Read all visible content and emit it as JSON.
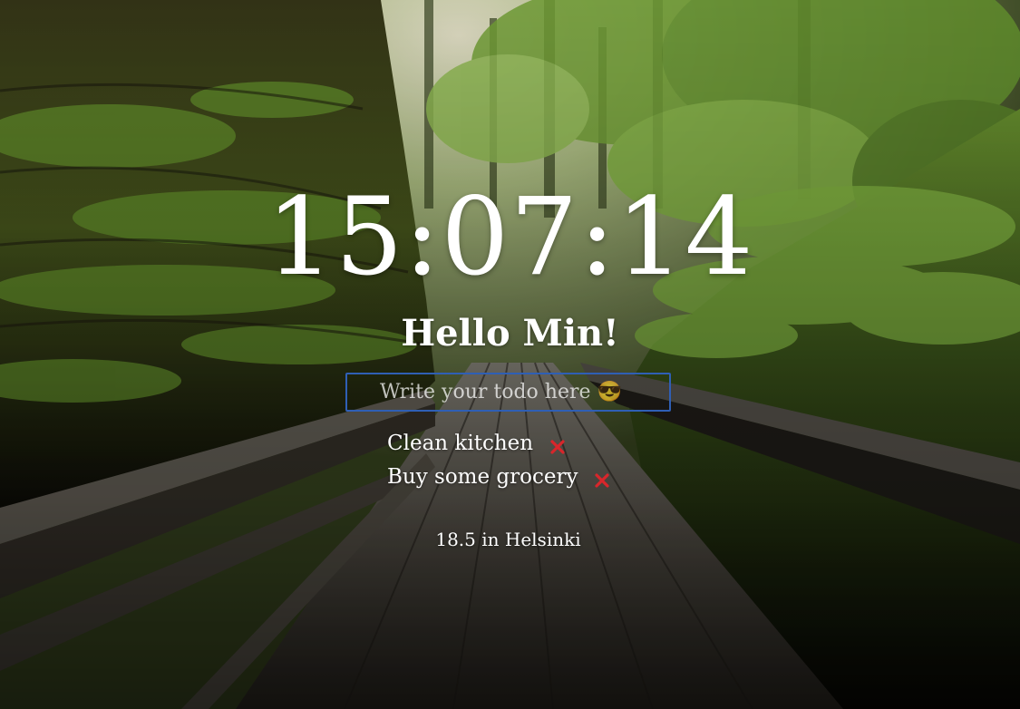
{
  "clock": {
    "time": "15:07:14"
  },
  "greeting": {
    "text": "Hello Min!"
  },
  "todo_form": {
    "placeholder": "Write your todo here 😎"
  },
  "todos": [
    {
      "text": "Clean kitchen",
      "delete_icon": "close-x-icon"
    },
    {
      "text": "Buy some grocery",
      "delete_icon": "close-x-icon"
    }
  ],
  "weather": {
    "text": "18.5 in Helsinki"
  },
  "colors": {
    "input_border": "#2f5fb5",
    "delete_icon": "#d8262b",
    "text": "#ffffff"
  }
}
